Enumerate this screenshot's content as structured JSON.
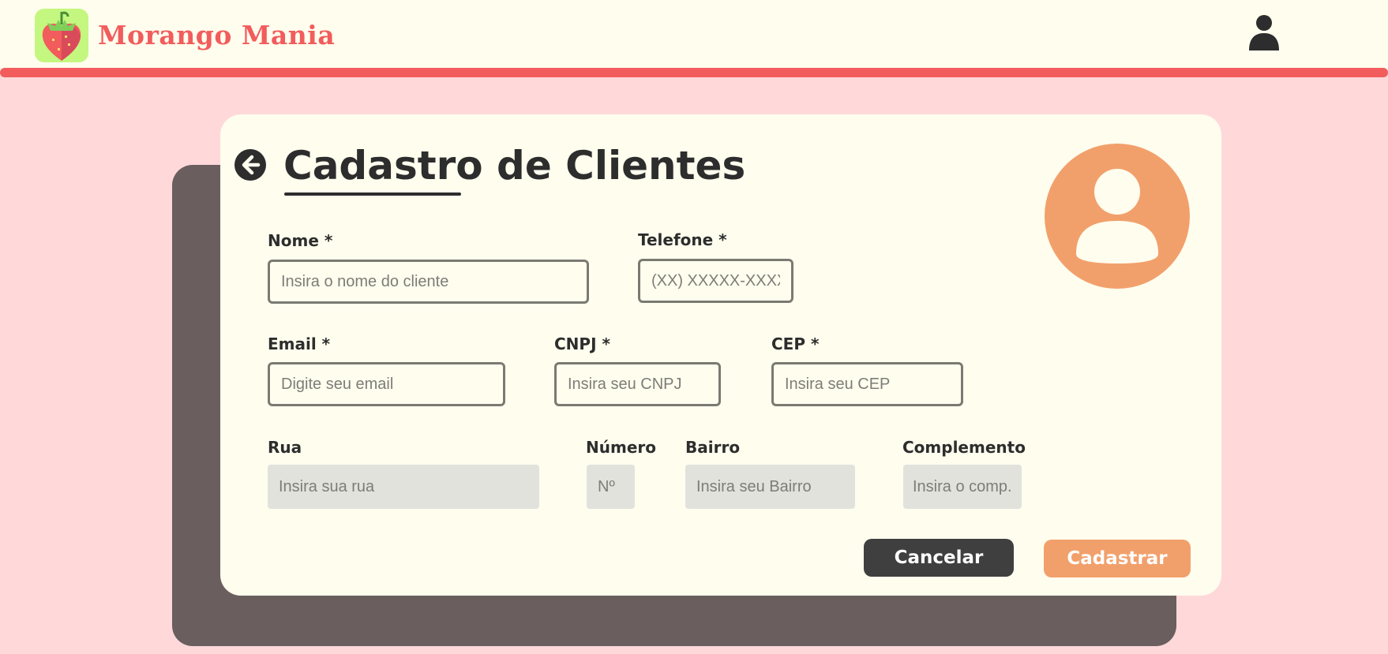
{
  "app": {
    "brand": "Morango Mania"
  },
  "header": {
    "logo_icon": "strawberry-icon",
    "user_icon": "user-icon"
  },
  "form": {
    "title": "Cadastro de Clientes",
    "back_icon": "arrow-left-circle-icon",
    "avatar_icon": "user-avatar-icon",
    "fields": {
      "nome": {
        "label": "Nome *",
        "placeholder": "Insira o nome do cliente"
      },
      "telefone": {
        "label": "Telefone *",
        "placeholder": "(XX) XXXXX-XXXX"
      },
      "email": {
        "label": "Email *",
        "placeholder": "Digite seu email"
      },
      "cnpj": {
        "label": "CNPJ *",
        "placeholder": "Insira seu CNPJ"
      },
      "cep": {
        "label": "CEP *",
        "placeholder": "Insira seu CEP"
      },
      "rua": {
        "label": "Rua",
        "placeholder": "Insira sua rua"
      },
      "numero": {
        "label": "Número",
        "placeholder": "Nº"
      },
      "bairro": {
        "label": "Bairro",
        "placeholder": "Insira seu Bairro"
      },
      "complemento": {
        "label": "Complemento",
        "placeholder": "Insira o comp."
      }
    },
    "buttons": {
      "cancel": "Cancelar",
      "submit": "Cadastrar"
    }
  },
  "colors": {
    "background": "#ffd8da",
    "header": "#fffdee",
    "accent_red": "#f25c5c",
    "accent_orange": "#f2a06b",
    "dark": "#3f3f3f",
    "logo_bg": "#c4f77f"
  }
}
